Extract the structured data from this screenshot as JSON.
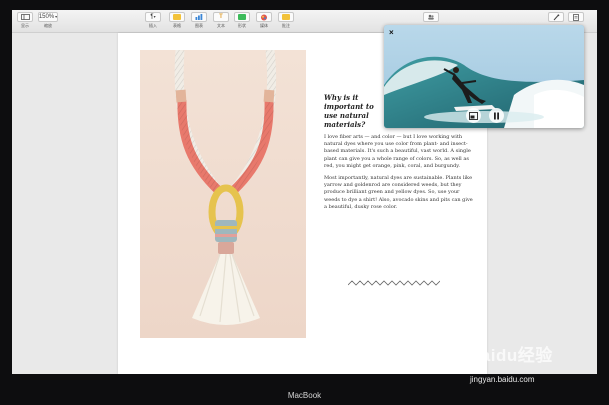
{
  "toolbar": {
    "view_label": "显示",
    "zoom_value": "150%",
    "zoom_label": "缩放",
    "insert_label": "插入",
    "table_label": "表格",
    "chart_label": "图表",
    "text_label": "文本",
    "shape_label": "形状",
    "media_label": "媒体",
    "comment_label": "批注",
    "insert_glyph": "¶",
    "text_glyph": "T"
  },
  "article": {
    "headline": "Why is it important to use natural materials?",
    "para1": "I love fiber arts — and color — but I love working with natural dyes where you use color from plant- and insect-based materials. It's such a beautiful, vast world. A single plant can give you a whole range of colors. So, as well as red, you might get orange, pink, coral, and burgundy.",
    "para2": "Most importantly, natural dyes are sustainable. Plants like yarrow and goldenrod are considered weeds, but they produce brilliant green and yellow dyes. So, use your weeds to dye a shirt! Also, avocado skins and pits can give a beautiful, dusky rose color."
  },
  "pip": {
    "close_glyph": "×"
  },
  "device": {
    "label": "MacBook"
  },
  "watermark": {
    "logo": "Baidu经验",
    "url": "jingyan.baidu.com"
  },
  "icons": {
    "view": "sidebar-view-icon",
    "insert": "paragraph-icon",
    "table": "table-icon",
    "chart": "bar-chart-icon",
    "text": "text-icon",
    "shape": "shape-icon",
    "media": "media-icon",
    "comment": "comment-icon",
    "collaborate": "collaborate-icon",
    "format": "format-brush-icon",
    "document": "document-icon",
    "pip_restore": "pip-restore-icon",
    "pause": "pause-icon"
  },
  "colors": {
    "toolbar_bg": "#e9e9e9",
    "page_bg": "#ffffff",
    "photo_bg": "#f1dcd0",
    "rope_coral": "#e8796c",
    "rope_yellow": "#e6c34e",
    "tassel": "#f7f3ea",
    "ocean": "#2f7f86",
    "sky": "#a9cde4"
  }
}
